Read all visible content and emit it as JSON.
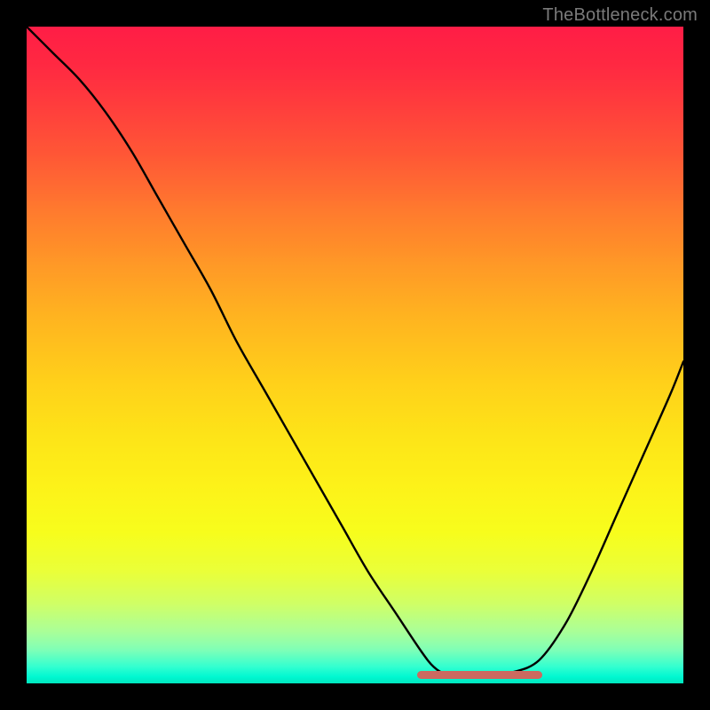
{
  "watermark": "TheBottleneck.com",
  "colors": {
    "background": "#000000",
    "watermark": "#7a7a7a",
    "curve": "#000000",
    "trough_segment": "#cb6a60"
  },
  "chart_data": {
    "type": "line",
    "title": "",
    "xlabel": "",
    "ylabel": "",
    "xlim": [
      0,
      100
    ],
    "ylim": [
      0,
      100
    ],
    "grid": false,
    "legend": false,
    "series": [
      {
        "name": "bottleneck-curve",
        "x": [
          0,
          4,
          8,
          12,
          16,
          20,
          24,
          28,
          32,
          36,
          40,
          44,
          48,
          52,
          56,
          60,
          62,
          64,
          66,
          70,
          74,
          78,
          82,
          86,
          90,
          94,
          98,
          100
        ],
        "y": [
          100,
          96,
          92,
          87,
          81,
          74,
          67,
          60,
          52,
          45,
          38,
          31,
          24,
          17,
          11,
          5,
          2.5,
          1.3,
          1.1,
          1.2,
          1.7,
          3.5,
          9,
          17,
          26,
          35,
          44,
          49
        ]
      }
    ],
    "trough": {
      "x_start": 60,
      "x_end": 78,
      "y": 1.2
    },
    "gradient_stops": [
      {
        "pos": 0,
        "color": "#ff1e49"
      },
      {
        "pos": 20,
        "color": "#ff5a36"
      },
      {
        "pos": 44,
        "color": "#ffb21f"
      },
      {
        "pos": 70,
        "color": "#fdf217"
      },
      {
        "pos": 88,
        "color": "#c9ff5d"
      },
      {
        "pos": 100,
        "color": "#00e3b4"
      }
    ]
  }
}
